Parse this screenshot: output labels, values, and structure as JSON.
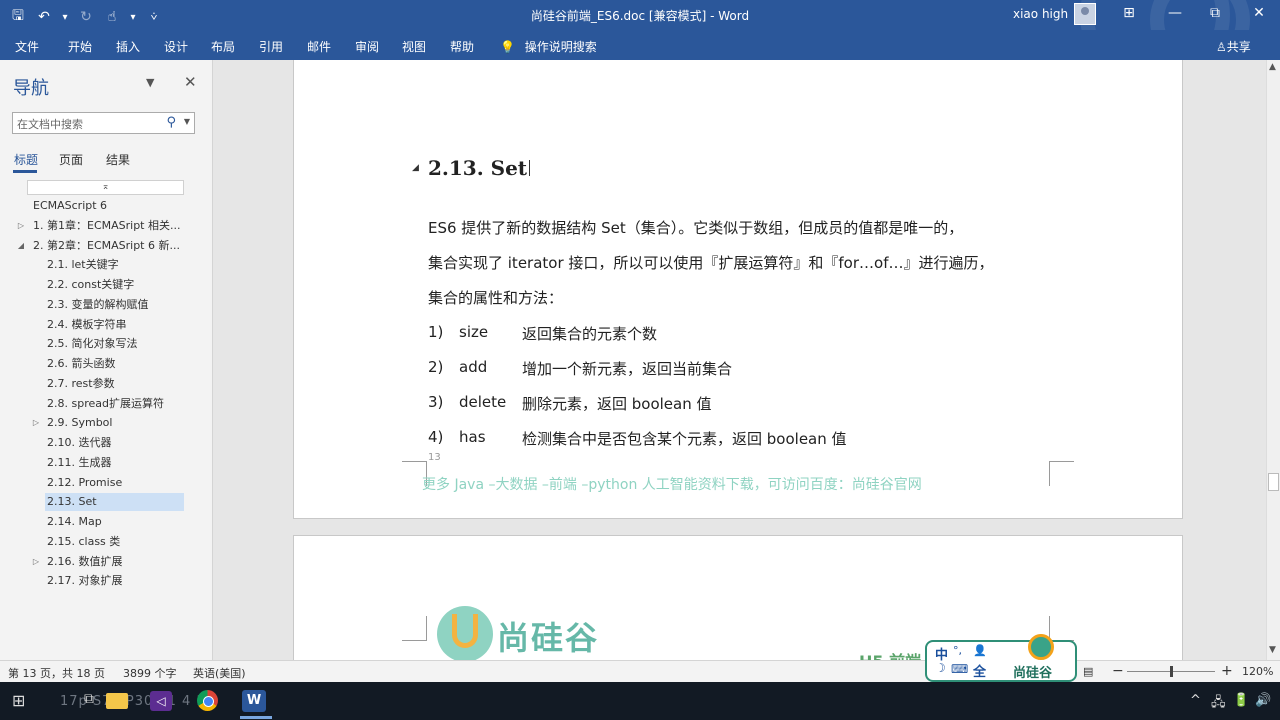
{
  "window": {
    "title": "尚硅谷前端_ES6.doc [兼容模式] - Word",
    "user": "xiao high",
    "controls": {
      "ribbon_display": "⊞",
      "restore": "⧉",
      "close": "✕"
    }
  },
  "qat": {
    "save": "🖫",
    "undo": "↶",
    "undo_dd": "▾",
    "redo": "↻",
    "touch": "☝",
    "touch_dd": "▾",
    "customize": "⩒"
  },
  "ribbon": {
    "tabs": [
      "文件",
      "开始",
      "插入",
      "设计",
      "布局",
      "引用",
      "邮件",
      "审阅",
      "视图",
      "帮助"
    ],
    "tell_me_icon": "lightbulb-icon",
    "tell_me": "操作说明搜索",
    "share": "共享"
  },
  "nav": {
    "title": "导航",
    "search_placeholder": "在文档中搜索",
    "tabs": [
      "标题",
      "页面",
      "结果"
    ],
    "active_tab": "标题",
    "collapse_glyph": "⌅",
    "headings": [
      {
        "text": "ECMAScript 6",
        "level": 0,
        "toggle": ""
      },
      {
        "text": "1. 第1章：ECMASript 相关...",
        "level": 0,
        "toggle": "▷"
      },
      {
        "text": "2. 第2章：ECMASript 6 新...",
        "level": 0,
        "toggle": "◢"
      },
      {
        "text": "2.1. let关键字",
        "level": 1,
        "toggle": ""
      },
      {
        "text": "2.2. const关键字",
        "level": 1,
        "toggle": ""
      },
      {
        "text": "2.3. 变量的解构赋值",
        "level": 1,
        "toggle": ""
      },
      {
        "text": "2.4. 模板字符串",
        "level": 1,
        "toggle": ""
      },
      {
        "text": "2.5. 简化对象写法",
        "level": 1,
        "toggle": ""
      },
      {
        "text": "2.6. 箭头函数",
        "level": 1,
        "toggle": ""
      },
      {
        "text": "2.7. rest参数",
        "level": 1,
        "toggle": ""
      },
      {
        "text": "2.8. spread扩展运算符",
        "level": 1,
        "toggle": ""
      },
      {
        "text": "2.9. Symbol",
        "level": 1,
        "toggle": "▷"
      },
      {
        "text": "2.10. 迭代器",
        "level": 1,
        "toggle": ""
      },
      {
        "text": "2.11. 生成器",
        "level": 1,
        "toggle": ""
      },
      {
        "text": "2.12. Promise",
        "level": 1,
        "toggle": ""
      },
      {
        "text": "2.13. Set",
        "level": 1,
        "toggle": "",
        "selected": true
      },
      {
        "text": "2.14. Map",
        "level": 1,
        "toggle": ""
      },
      {
        "text": "2.15. class 类",
        "level": 1,
        "toggle": ""
      },
      {
        "text": "2.16. 数值扩展",
        "level": 1,
        "toggle": "▷"
      },
      {
        "text": "2.17. 对象扩展",
        "level": 1,
        "toggle": ""
      }
    ]
  },
  "document": {
    "heading": "2.13. Set",
    "paragraph_lines": [
      "ES6 提供了新的数据结构 Set（集合）。它类似于数组，但成员的值都是唯一的，",
      "集合实现了 iterator 接口，所以可以使用『扩展运算符』和『for…of…』进行遍历，",
      "集合的属性和方法："
    ],
    "list": [
      {
        "num": "1)",
        "term": "size",
        "desc": "返回集合的元素个数"
      },
      {
        "num": "2)",
        "term": "add",
        "desc": "增加一个新元素，返回当前集合"
      },
      {
        "num": "3)",
        "term": "delete",
        "desc": "删除元素，返回 boolean 值"
      },
      {
        "num": "4)",
        "term": "has",
        "desc": "检测集合中是否包含某个元素，返回 boolean 值"
      }
    ],
    "page_number": "13",
    "footer_note": "更多 Java –大数据 –前端 –python 人工智能资料下载，可访问百度：尚硅谷官网",
    "page2_logo": "尚硅谷",
    "page2_header": "H5 前端"
  },
  "ime": {
    "zh": "中",
    "dots": "°,",
    "person": "👤",
    "moon": "☽",
    "keyboard": "⌨",
    "full": "全",
    "brand": "尚硅谷"
  },
  "status": {
    "page": "第 13 页，共 18 页",
    "words": "3899 个字",
    "lang": "英语(美国)",
    "zoom_minus": "−",
    "zoom_plus": "+",
    "zoom": "120%",
    "zoom_level": 0.5
  },
  "taskbar": {
    "watermark": "17p S76 P30 31 4 39",
    "tray": [
      "^",
      "🖧",
      "🔋",
      "🔊"
    ]
  }
}
